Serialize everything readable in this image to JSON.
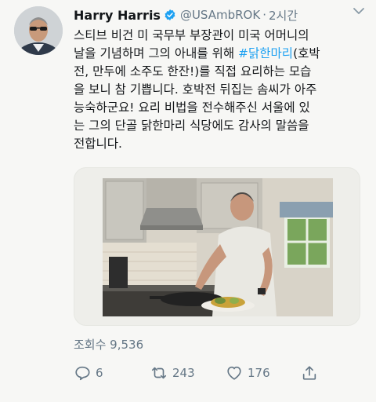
{
  "tweet": {
    "author_name": "Harry Harris",
    "handle": "@USAmbROK",
    "separator": "·",
    "time": "2시간",
    "text_lines": [
      {
        "before": "스티브 비건 미 국무부 부장관이 미국 어머니의",
        "tag": "",
        "after": ""
      },
      {
        "before": "날을 기념하며 그의 아내를 위해 ",
        "tag": "#닭한마리",
        "after": "(호박"
      },
      {
        "before": "전, 만두에 소주도 한잔!)를 직접 요리하는 모습",
        "tag": "",
        "after": ""
      },
      {
        "before": "을 보니 참 기쁩니다. 호박전 뒤집는 솜씨가 아주",
        "tag": "",
        "after": ""
      },
      {
        "before": "능숙하군요! 요리 비법을 전수해주신 서울에 있",
        "tag": "",
        "after": ""
      },
      {
        "before": "는 그의 단골 닭한마리 식당에도 감사의 말씀을",
        "tag": "",
        "after": ""
      },
      {
        "before": "전합니다.",
        "tag": "",
        "after": ""
      }
    ],
    "views": "조회수 9,536",
    "replies": "6",
    "retweets": "243",
    "likes": "176"
  },
  "icons": {
    "verified": "verified-badge-icon",
    "caret": "chevron-down-icon",
    "reply": "reply-icon",
    "retweet": "retweet-icon",
    "like": "heart-icon",
    "share": "share-icon"
  },
  "colors": {
    "accent": "#1da1f2",
    "muted": "#657786",
    "text": "#14171a",
    "background": "#f7f7f5"
  }
}
